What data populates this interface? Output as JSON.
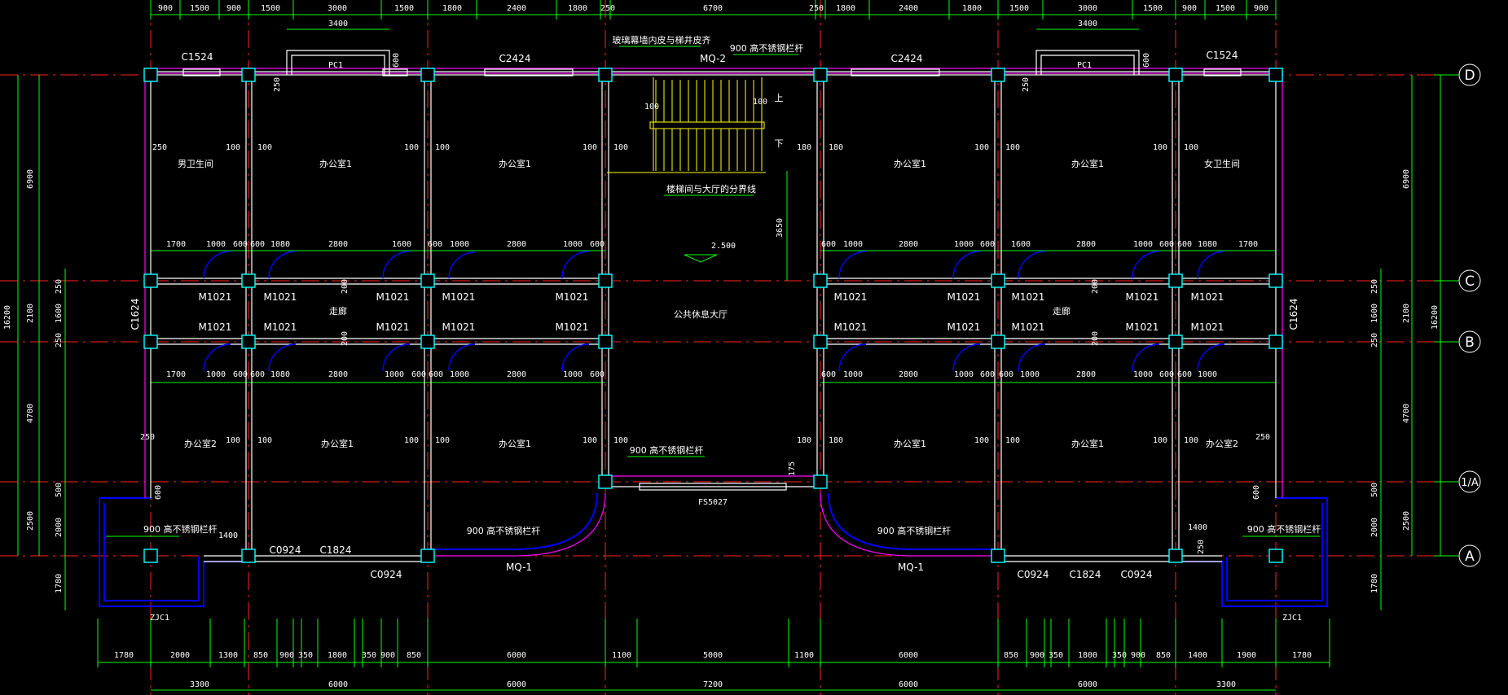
{
  "axes": {
    "right": [
      "D",
      "C",
      "B",
      "1/A",
      "A"
    ]
  },
  "top_dims_row1": [
    "900",
    "1500",
    "900",
    "1500",
    "3000",
    "1500",
    "1800",
    "2400",
    "1800",
    "250",
    "6700",
    "250",
    "1800",
    "2400",
    "1800",
    "1500",
    "3000",
    "1500",
    "900",
    "1500",
    "900"
  ],
  "top_dims_row2": [
    "3400",
    "3400"
  ],
  "bottom_dims_row1": [
    "1780",
    "2000",
    "1300",
    "850",
    "900",
    "350",
    "1800",
    "350",
    "900",
    "850",
    "6000",
    "1100",
    "5000",
    "1100",
    "6000",
    "850",
    "900",
    "350",
    "1800",
    "350",
    "900",
    "850",
    "1400",
    "1900",
    "1780"
  ],
  "bottom_dims_row2": [
    "3300",
    "6000",
    "6000",
    "7200",
    "6000",
    "6000",
    "3300"
  ],
  "left_dims_outer": [
    "6900",
    "16200",
    "2100",
    "4700",
    "2500"
  ],
  "left_dims_inner": [
    "250",
    "1600",
    "250",
    "500",
    "2000",
    "1780"
  ],
  "right_dims_outer": [
    "6900",
    "16200",
    "2100",
    "4700",
    "2500"
  ],
  "right_dims_inner": [
    "250",
    "1600",
    "250",
    "500",
    "2000",
    "1780"
  ],
  "rooms": {
    "mens_wc": "男卫生间",
    "womens_wc": "女卫生间",
    "office1": "办公室1",
    "office2": "办公室2",
    "corridor": "走廊",
    "hall": "公共休息大厅"
  },
  "windows": {
    "c1524": "C1524",
    "c2424": "C2424",
    "pc1": "PC1",
    "c1624": "C1624",
    "c0924": "C0924",
    "c1824": "C1824"
  },
  "doors": {
    "m1021": "M1021",
    "mq1": "MQ-1",
    "mq2": "MQ-2",
    "fs5027": "FS5027"
  },
  "notes": {
    "glass_wall": "玻璃幕墙内皮与梯井皮齐",
    "railing": "900 高不锈钢栏杆",
    "stair_boundary": "楼梯间与大厅的分界线",
    "elevation": "2.500",
    "up": "上",
    "down": "下",
    "zjc": "ZJC1"
  },
  "interior_dims": {
    "d100": "100",
    "d250": "250",
    "d180": "180",
    "d600": "600",
    "d1000": "1000",
    "d1080": "1080",
    "d1600": "1600",
    "d1700": "1700",
    "d2800": "2800",
    "d3650": "3650",
    "d1400": "1400",
    "d175": "175",
    "d200": "200"
  }
}
